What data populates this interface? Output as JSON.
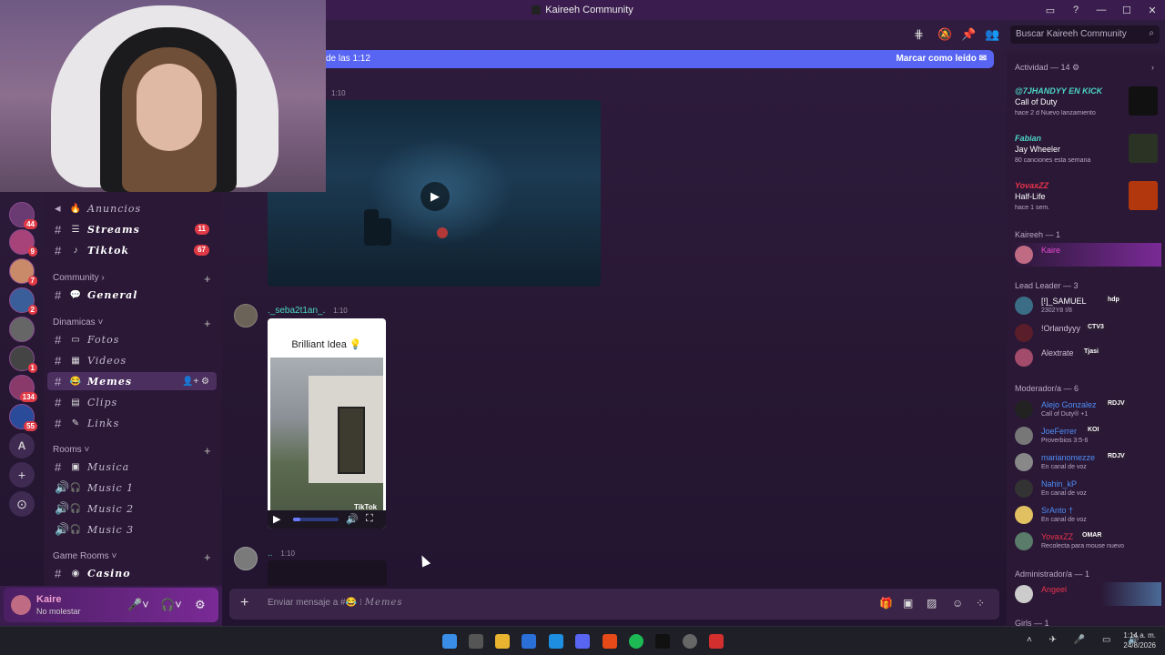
{
  "window": {
    "title": "Kaireeh Community"
  },
  "server_badges": [
    "44",
    "9",
    "7",
    "2",
    "1",
    "134",
    "55"
  ],
  "server_letter": "A",
  "channels": {
    "anuncios": "Anuncios",
    "streams": "Streams",
    "streams_count": "11",
    "tiktok": "Tiktok",
    "tiktok_count": "67",
    "cat_community": "Community",
    "general": "General",
    "cat_dinamicas": "Dinamicas",
    "fotos": "Fotos",
    "videos": "Videos",
    "memes": "Memes",
    "clips": "Clips",
    "links": "Links",
    "cat_rooms": "Rooms",
    "musica": "Musica",
    "music1": "Music 1",
    "music2": "Music 2",
    "music3": "Music 3",
    "cat_game": "Game Rooms",
    "casino": "Casino"
  },
  "user": {
    "name": "Kaire",
    "status": "No molestar"
  },
  "search": {
    "placeholder": "Buscar Kaireeh Community"
  },
  "new_messages": {
    "text": "de las 1:12",
    "action": "Marcar como leído"
  },
  "messages": [
    {
      "time": "1:10"
    },
    {
      "author": "._seba2t1an_.",
      "time": "1:10",
      "caption": "Brilliant Idea 💡",
      "watermark": "TikTok"
    },
    {
      "author": "..",
      "time": "1:10"
    }
  ],
  "composer": {
    "placeholder_prefix": "Enviar mensaje a #",
    "placeholder_channel": "Memes"
  },
  "members": {
    "activity_header": "Actividad — 14",
    "activities": [
      {
        "user": "@7JHANDYY EN KICK",
        "title": "Call of Duty",
        "sub": "hace 2 d   Nuevo lanzamiento",
        "color": "#4cd6c6"
      },
      {
        "user": "Fabian",
        "title": "Jay Wheeler",
        "sub": "80 canciones esta semana",
        "color": "#4cd6c6"
      },
      {
        "user": "YovaxZZ",
        "title": "Half-Life",
        "sub": "hace 1 sem.",
        "color": "#e8334b"
      }
    ],
    "kaireeh_header": "Kaireeh — 1",
    "kaireeh": [
      {
        "name": "Kaire"
      }
    ],
    "lead_header": "Lead Leader — 3",
    "lead": [
      {
        "name": "[!]_SAMUEL",
        "tag": "hdp",
        "sub": "2302Y8 !/8"
      },
      {
        "name": "!Orlandyyy",
        "tag": "CTV3"
      },
      {
        "name": "Alextrate",
        "tag": "Tjasi"
      }
    ],
    "mod_header": "Moderador/a — 6",
    "mods": [
      {
        "name": "Alejo Gonzalez",
        "tag": "RDJV",
        "sub": "Call of Duty® +1"
      },
      {
        "name": "JoeFerrer",
        "tag": "KOI",
        "sub": "Proverbios 3:5-6"
      },
      {
        "name": "marianomezze",
        "tag": "RDJV",
        "sub": "En canal de voz"
      },
      {
        "name": "Nahin_kP",
        "sub": "En canal de voz"
      },
      {
        "name": "SrAnto †",
        "sub": "En canal de voz"
      },
      {
        "name": "YovaxZZ",
        "tag": "OMAR",
        "sub": "Recolecta para mouse nuevo"
      }
    ],
    "admin_header": "Administrador/a — 1",
    "admins": [
      {
        "name": "Angeel"
      }
    ],
    "girls_header": "Girls — 1"
  },
  "clock": {
    "time": "1:14 a. m.",
    "date": "24/8/2026"
  }
}
